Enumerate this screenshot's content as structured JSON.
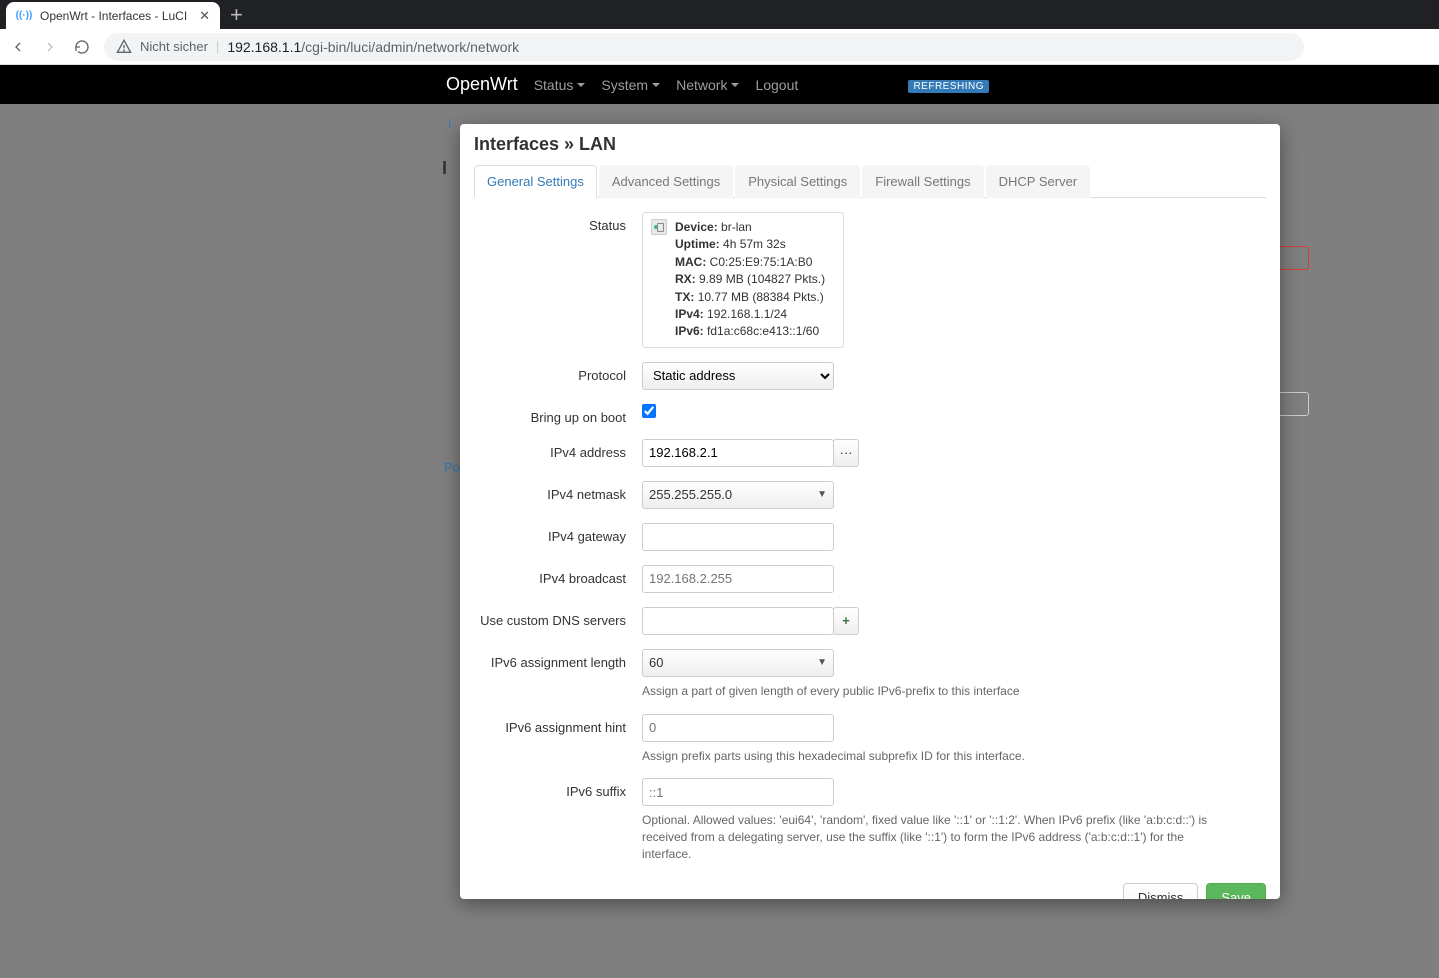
{
  "browser": {
    "tab_title": "OpenWrt - Interfaces - LuCI",
    "security_text": "Nicht sicher",
    "url_host": "192.168.1.1",
    "url_path": "/cgi-bin/luci/admin/network/network"
  },
  "header": {
    "brand": "OpenWrt",
    "menu_status": "Status",
    "menu_system": "System",
    "menu_network": "Network",
    "menu_logout": "Logout",
    "refreshing": "REFRESHING"
  },
  "bg": {
    "interfaces_link": "I",
    "page_title": "I",
    "powered": "Po"
  },
  "modal": {
    "title": "Interfaces » LAN",
    "tabs": {
      "general": "General Settings",
      "advanced": "Advanced Settings",
      "physical": "Physical Settings",
      "firewall": "Firewall Settings",
      "dhcp": "DHCP Server"
    },
    "labels": {
      "status": "Status",
      "protocol": "Protocol",
      "bringup": "Bring up on boot",
      "ipv4addr": "IPv4 address",
      "ipv4netmask": "IPv4 netmask",
      "ipv4gateway": "IPv4 gateway",
      "ipv4broadcast": "IPv4 broadcast",
      "customdns": "Use custom DNS servers",
      "ipv6assignlen": "IPv6 assignment length",
      "ipv6assignhint": "IPv6 assignment hint",
      "ipv6suffix": "IPv6 suffix"
    },
    "status": {
      "device_label": "Device:",
      "device": "br-lan",
      "uptime_label": "Uptime:",
      "uptime": "4h 57m 32s",
      "mac_label": "MAC:",
      "mac": "C0:25:E9:75:1A:B0",
      "rx_label": "RX:",
      "rx": "9.89 MB (104827 Pkts.)",
      "tx_label": "TX:",
      "tx": "10.77 MB (88384 Pkts.)",
      "ipv4_label": "IPv4:",
      "ipv4": "192.168.1.1/24",
      "ipv6_label": "IPv6:",
      "ipv6": "fd1a:c68c:e413::1/60"
    },
    "values": {
      "protocol": "Static address",
      "ipv4addr": "192.168.2.1",
      "ipv4netmask": "255.255.255.0",
      "ipv4gateway": "",
      "ipv4broadcast_placeholder": "192.168.2.255",
      "customdns": "",
      "ipv6assignlen": "60",
      "ipv6assignhint_placeholder": "0",
      "ipv6suffix_placeholder": "::1"
    },
    "help": {
      "assignlen": "Assign a part of given length of every public IPv6-prefix to this interface",
      "assignhint": "Assign prefix parts using this hexadecimal subprefix ID for this interface.",
      "suffix": "Optional. Allowed values: 'eui64', 'random', fixed value like '::1' or '::1:2'. When IPv6 prefix (like 'a:b:c:d::') is received from a delegating server, use the suffix (like '::1') to form the IPv6 address ('a:b:c:d::1') for the interface."
    },
    "buttons": {
      "dismiss": "Dismiss",
      "save": "Save",
      "more": "···",
      "add": "+"
    }
  }
}
